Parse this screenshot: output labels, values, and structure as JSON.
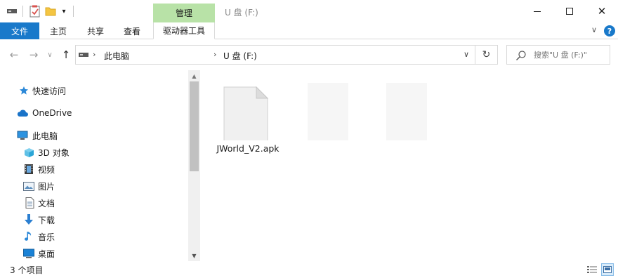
{
  "window": {
    "title": "U 盘 (F:)",
    "contextual_tab_header": "管理"
  },
  "ribbon": {
    "tabs": [
      {
        "label": "文件"
      },
      {
        "label": "主页"
      },
      {
        "label": "共享"
      },
      {
        "label": "查看"
      },
      {
        "label": "驱动器工具"
      }
    ]
  },
  "address": {
    "crumbs": [
      {
        "label": "此电脑"
      },
      {
        "label": "U 盘 (F:)"
      }
    ],
    "search_placeholder": "搜索\"U 盘 (F:)\""
  },
  "navpane": {
    "items": [
      {
        "label": "快速访问",
        "icon": "star-icon"
      },
      {
        "label": "OneDrive",
        "icon": "cloud-icon"
      },
      {
        "label": "此电脑",
        "icon": "computer-icon"
      },
      {
        "label": "3D 对象",
        "icon": "cube-icon"
      },
      {
        "label": "视频",
        "icon": "film-icon"
      },
      {
        "label": "图片",
        "icon": "picture-icon"
      },
      {
        "label": "文档",
        "icon": "document-icon"
      },
      {
        "label": "下载",
        "icon": "download-icon"
      },
      {
        "label": "音乐",
        "icon": "music-icon"
      },
      {
        "label": "桌面",
        "icon": "desktop-icon"
      }
    ]
  },
  "files": [
    {
      "name": "JWorld_V2.apk",
      "icon": "file-icon"
    }
  ],
  "status": {
    "item_count": "3 个项目"
  },
  "colors": {
    "accent": "#1979ca",
    "manage_tab": "#b8e2a7"
  }
}
